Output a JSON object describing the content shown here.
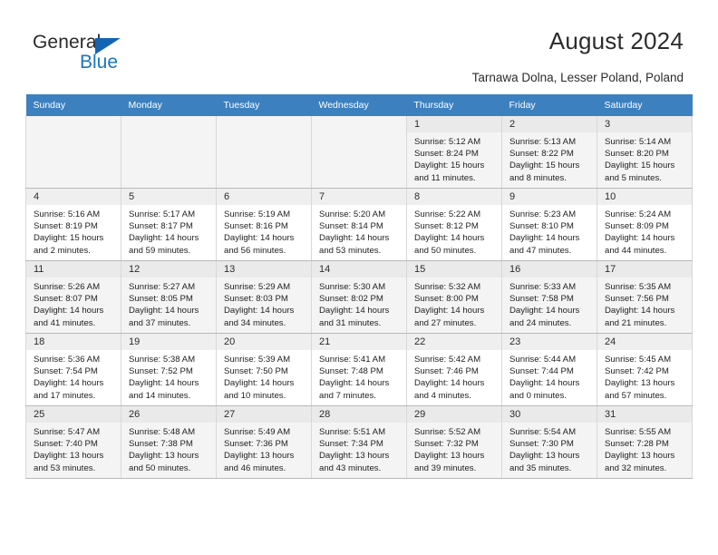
{
  "brand": {
    "name_part1": "General",
    "name_part2": "Blue",
    "flag_icon": "triangle-flag-icon"
  },
  "header": {
    "title": "August 2024",
    "location": "Tarnawa Dolna, Lesser Poland, Poland"
  },
  "colors": {
    "header_blue": "#3d80bf",
    "brand_blue": "#1b75bc",
    "flag_blue": "#1464b4",
    "alt_row": "#f4f4f4",
    "daynum_bg": "#efefef"
  },
  "weekdays": [
    "Sunday",
    "Monday",
    "Tuesday",
    "Wednesday",
    "Thursday",
    "Friday",
    "Saturday"
  ],
  "weeks": [
    [
      {
        "day": "",
        "sunrise": "",
        "sunset": "",
        "daylight1": "",
        "daylight2": ""
      },
      {
        "day": "",
        "sunrise": "",
        "sunset": "",
        "daylight1": "",
        "daylight2": ""
      },
      {
        "day": "",
        "sunrise": "",
        "sunset": "",
        "daylight1": "",
        "daylight2": ""
      },
      {
        "day": "",
        "sunrise": "",
        "sunset": "",
        "daylight1": "",
        "daylight2": ""
      },
      {
        "day": "1",
        "sunrise": "Sunrise: 5:12 AM",
        "sunset": "Sunset: 8:24 PM",
        "daylight1": "Daylight: 15 hours",
        "daylight2": "and 11 minutes."
      },
      {
        "day": "2",
        "sunrise": "Sunrise: 5:13 AM",
        "sunset": "Sunset: 8:22 PM",
        "daylight1": "Daylight: 15 hours",
        "daylight2": "and 8 minutes."
      },
      {
        "day": "3",
        "sunrise": "Sunrise: 5:14 AM",
        "sunset": "Sunset: 8:20 PM",
        "daylight1": "Daylight: 15 hours",
        "daylight2": "and 5 minutes."
      }
    ],
    [
      {
        "day": "4",
        "sunrise": "Sunrise: 5:16 AM",
        "sunset": "Sunset: 8:19 PM",
        "daylight1": "Daylight: 15 hours",
        "daylight2": "and 2 minutes."
      },
      {
        "day": "5",
        "sunrise": "Sunrise: 5:17 AM",
        "sunset": "Sunset: 8:17 PM",
        "daylight1": "Daylight: 14 hours",
        "daylight2": "and 59 minutes."
      },
      {
        "day": "6",
        "sunrise": "Sunrise: 5:19 AM",
        "sunset": "Sunset: 8:16 PM",
        "daylight1": "Daylight: 14 hours",
        "daylight2": "and 56 minutes."
      },
      {
        "day": "7",
        "sunrise": "Sunrise: 5:20 AM",
        "sunset": "Sunset: 8:14 PM",
        "daylight1": "Daylight: 14 hours",
        "daylight2": "and 53 minutes."
      },
      {
        "day": "8",
        "sunrise": "Sunrise: 5:22 AM",
        "sunset": "Sunset: 8:12 PM",
        "daylight1": "Daylight: 14 hours",
        "daylight2": "and 50 minutes."
      },
      {
        "day": "9",
        "sunrise": "Sunrise: 5:23 AM",
        "sunset": "Sunset: 8:10 PM",
        "daylight1": "Daylight: 14 hours",
        "daylight2": "and 47 minutes."
      },
      {
        "day": "10",
        "sunrise": "Sunrise: 5:24 AM",
        "sunset": "Sunset: 8:09 PM",
        "daylight1": "Daylight: 14 hours",
        "daylight2": "and 44 minutes."
      }
    ],
    [
      {
        "day": "11",
        "sunrise": "Sunrise: 5:26 AM",
        "sunset": "Sunset: 8:07 PM",
        "daylight1": "Daylight: 14 hours",
        "daylight2": "and 41 minutes."
      },
      {
        "day": "12",
        "sunrise": "Sunrise: 5:27 AM",
        "sunset": "Sunset: 8:05 PM",
        "daylight1": "Daylight: 14 hours",
        "daylight2": "and 37 minutes."
      },
      {
        "day": "13",
        "sunrise": "Sunrise: 5:29 AM",
        "sunset": "Sunset: 8:03 PM",
        "daylight1": "Daylight: 14 hours",
        "daylight2": "and 34 minutes."
      },
      {
        "day": "14",
        "sunrise": "Sunrise: 5:30 AM",
        "sunset": "Sunset: 8:02 PM",
        "daylight1": "Daylight: 14 hours",
        "daylight2": "and 31 minutes."
      },
      {
        "day": "15",
        "sunrise": "Sunrise: 5:32 AM",
        "sunset": "Sunset: 8:00 PM",
        "daylight1": "Daylight: 14 hours",
        "daylight2": "and 27 minutes."
      },
      {
        "day": "16",
        "sunrise": "Sunrise: 5:33 AM",
        "sunset": "Sunset: 7:58 PM",
        "daylight1": "Daylight: 14 hours",
        "daylight2": "and 24 minutes."
      },
      {
        "day": "17",
        "sunrise": "Sunrise: 5:35 AM",
        "sunset": "Sunset: 7:56 PM",
        "daylight1": "Daylight: 14 hours",
        "daylight2": "and 21 minutes."
      }
    ],
    [
      {
        "day": "18",
        "sunrise": "Sunrise: 5:36 AM",
        "sunset": "Sunset: 7:54 PM",
        "daylight1": "Daylight: 14 hours",
        "daylight2": "and 17 minutes."
      },
      {
        "day": "19",
        "sunrise": "Sunrise: 5:38 AM",
        "sunset": "Sunset: 7:52 PM",
        "daylight1": "Daylight: 14 hours",
        "daylight2": "and 14 minutes."
      },
      {
        "day": "20",
        "sunrise": "Sunrise: 5:39 AM",
        "sunset": "Sunset: 7:50 PM",
        "daylight1": "Daylight: 14 hours",
        "daylight2": "and 10 minutes."
      },
      {
        "day": "21",
        "sunrise": "Sunrise: 5:41 AM",
        "sunset": "Sunset: 7:48 PM",
        "daylight1": "Daylight: 14 hours",
        "daylight2": "and 7 minutes."
      },
      {
        "day": "22",
        "sunrise": "Sunrise: 5:42 AM",
        "sunset": "Sunset: 7:46 PM",
        "daylight1": "Daylight: 14 hours",
        "daylight2": "and 4 minutes."
      },
      {
        "day": "23",
        "sunrise": "Sunrise: 5:44 AM",
        "sunset": "Sunset: 7:44 PM",
        "daylight1": "Daylight: 14 hours",
        "daylight2": "and 0 minutes."
      },
      {
        "day": "24",
        "sunrise": "Sunrise: 5:45 AM",
        "sunset": "Sunset: 7:42 PM",
        "daylight1": "Daylight: 13 hours",
        "daylight2": "and 57 minutes."
      }
    ],
    [
      {
        "day": "25",
        "sunrise": "Sunrise: 5:47 AM",
        "sunset": "Sunset: 7:40 PM",
        "daylight1": "Daylight: 13 hours",
        "daylight2": "and 53 minutes."
      },
      {
        "day": "26",
        "sunrise": "Sunrise: 5:48 AM",
        "sunset": "Sunset: 7:38 PM",
        "daylight1": "Daylight: 13 hours",
        "daylight2": "and 50 minutes."
      },
      {
        "day": "27",
        "sunrise": "Sunrise: 5:49 AM",
        "sunset": "Sunset: 7:36 PM",
        "daylight1": "Daylight: 13 hours",
        "daylight2": "and 46 minutes."
      },
      {
        "day": "28",
        "sunrise": "Sunrise: 5:51 AM",
        "sunset": "Sunset: 7:34 PM",
        "daylight1": "Daylight: 13 hours",
        "daylight2": "and 43 minutes."
      },
      {
        "day": "29",
        "sunrise": "Sunrise: 5:52 AM",
        "sunset": "Sunset: 7:32 PM",
        "daylight1": "Daylight: 13 hours",
        "daylight2": "and 39 minutes."
      },
      {
        "day": "30",
        "sunrise": "Sunrise: 5:54 AM",
        "sunset": "Sunset: 7:30 PM",
        "daylight1": "Daylight: 13 hours",
        "daylight2": "and 35 minutes."
      },
      {
        "day": "31",
        "sunrise": "Sunrise: 5:55 AM",
        "sunset": "Sunset: 7:28 PM",
        "daylight1": "Daylight: 13 hours",
        "daylight2": "and 32 minutes."
      }
    ]
  ]
}
